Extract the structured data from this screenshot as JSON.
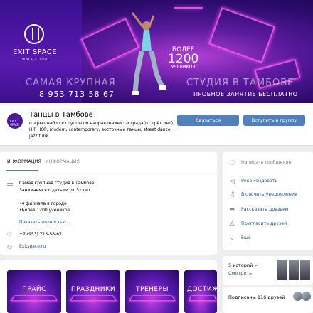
{
  "cover": {
    "brand": "EXIT SPACE",
    "brand_sub": "DANCE STUDIO",
    "tagline_left": "САМАЯ КРУПНАЯ",
    "tagline_right": "СТУДИЯ В ТАМБОВЕ",
    "phone": "8 953 713 58 67",
    "promo": "ПРОБНОЕ ЗАНЯТИЕ БЕСПЛАТНО",
    "big_l1": "БОЛЕЕ",
    "big_l2": "1200",
    "big_l3": "УЧЕНИКОВ"
  },
  "header": {
    "avatar_text": "EXIT SPACE",
    "title": "Танцы в Тамбове",
    "status": "открыт набор в группы по направлениям: эстрада(от трёх лет), HIP HOP, modern, contemporary, восточные танцы, street dance, jazz funk.",
    "message_button": "Связаться",
    "join_button": "Вступить в группу"
  },
  "info": {
    "tab_info": "ИНФОРМАЦИЯ",
    "tab_contacts": "ИНФОРМАЦИЯ",
    "desc_line1": "Самая крупная студия в Тамбове!",
    "desc_line2": "Занимаемся с детьми от 3х лет",
    "desc_line3": "•4 филиала в городе",
    "desc_line4": "•Более 1200 учеников",
    "more": "Показать полностью...",
    "phone": "+7 (953) 713-58-67",
    "site": "Exitspace.ru"
  },
  "side_menu": {
    "items": [
      {
        "label": "Написать сообщение",
        "icon": "message-icon"
      },
      {
        "label": "Рекомендовать",
        "icon": "megaphone-icon"
      },
      {
        "label": "Включить уведомления",
        "icon": "bell-icon"
      },
      {
        "label": "Рассказать друзьям",
        "icon": "share-icon"
      },
      {
        "label": "Пригласить друзей",
        "icon": "add-user-icon"
      },
      {
        "label": "Ещё",
        "icon": "chevron-down-icon"
      }
    ]
  },
  "stories": {
    "count": "5 историй »",
    "watch": "Смотреть"
  },
  "subscribers": {
    "label": "Подписаны 116 друзей"
  },
  "tiles": [
    {
      "label": "ПРАЙС"
    },
    {
      "label": "ПРАЗДНИКИ"
    },
    {
      "label": "ТРЕНЕРЫ"
    },
    {
      "label": "ДОСТИЖЕ"
    }
  ]
}
